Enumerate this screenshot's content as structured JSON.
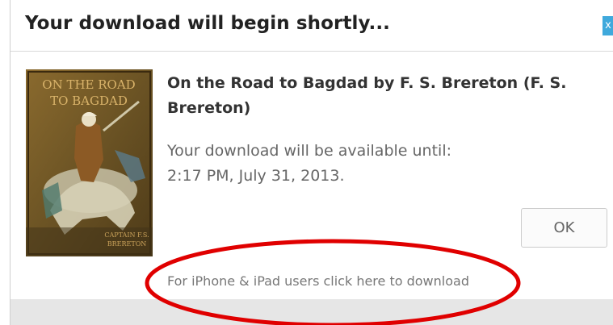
{
  "dialog": {
    "title": "Your download will begin shortly...",
    "close_label": "x"
  },
  "book": {
    "title_line1": "On the Road to Bagdad by F. S. Brereton (F. S.",
    "title_line2": "Brereton)",
    "cover": {
      "title_line1": "ON THE ROAD",
      "title_line2": "TO BAGDAD",
      "author_line1": "CAPTAIN F.S.",
      "author_line2": "BRERETON"
    }
  },
  "availability": {
    "line1": "Your download will be available until:",
    "line2": "2:17 PM, July 31, 2013."
  },
  "ok_button": {
    "label": "OK"
  },
  "iphone_link": {
    "label": "For iPhone & iPad users click here to download"
  },
  "colors": {
    "annotation": "#e00000",
    "close_button": "#3fa9dc",
    "footer": "#e6e6e6"
  }
}
